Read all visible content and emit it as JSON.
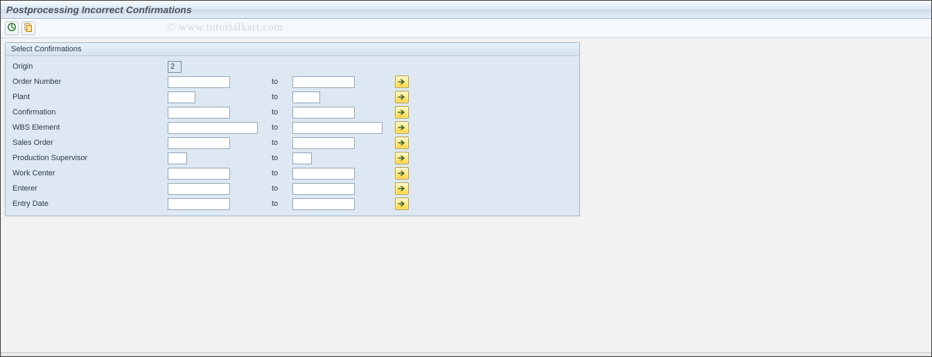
{
  "page": {
    "title": "Postprocessing Incorrect Confirmations"
  },
  "toolbar": {
    "execute_icon": "execute-icon",
    "variant_icon": "variant-icon"
  },
  "watermark": "© www.tutorialkart.com",
  "group": {
    "title": "Select Confirmations",
    "to_label": "to",
    "origin": {
      "label": "Origin",
      "value": "2"
    },
    "rows": {
      "order_number": {
        "label": "Order Number",
        "from": "",
        "to": "",
        "from_w": "w-med",
        "to_w": "w-med"
      },
      "plant": {
        "label": "Plant",
        "from": "",
        "to": "",
        "from_w": "w-small",
        "to_w": "w-small"
      },
      "confirmation": {
        "label": "Confirmation",
        "from": "",
        "to": "",
        "from_w": "w-med",
        "to_w": "w-med"
      },
      "wbs_element": {
        "label": "WBS Element",
        "from": "",
        "to": "",
        "from_w": "w-wide",
        "to_w": "w-wide"
      },
      "sales_order": {
        "label": "Sales Order",
        "from": "",
        "to": "",
        "from_w": "w-med",
        "to_w": "w-med"
      },
      "production_supervisor": {
        "label": "Production Supervisor",
        "from": "",
        "to": "",
        "from_w": "w-tiny",
        "to_w": "w-tiny"
      },
      "work_center": {
        "label": "Work Center",
        "from": "",
        "to": "",
        "from_w": "w-med",
        "to_w": "w-med"
      },
      "enterer": {
        "label": "Enterer",
        "from": "",
        "to": "",
        "from_w": "w-med",
        "to_w": "w-med"
      },
      "entry_date": {
        "label": "Entry Date",
        "from": "",
        "to": "",
        "from_w": "w-med",
        "to_w": "w-med"
      }
    }
  }
}
